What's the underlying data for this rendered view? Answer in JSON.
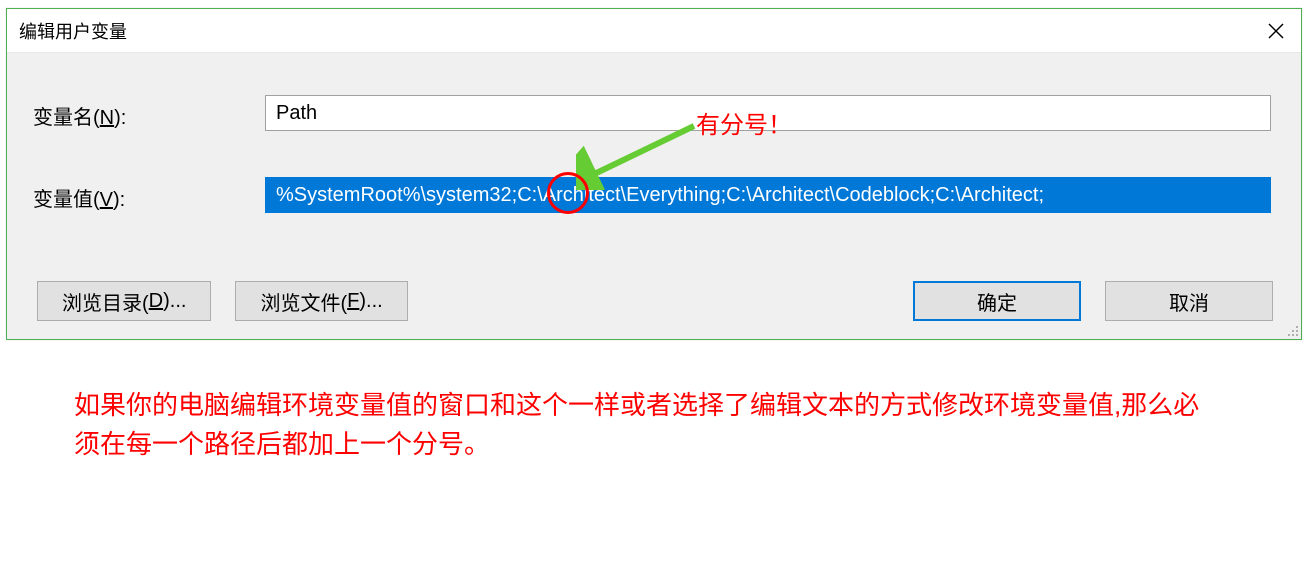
{
  "dialog": {
    "title": "编辑用户变量",
    "name_label_prefix": "变量名(",
    "name_label_key": "N",
    "name_label_suffix": "):",
    "name_value": "Path",
    "value_label_prefix": "变量值(",
    "value_label_key": "V",
    "value_label_suffix": "):",
    "value_value": "%SystemRoot%\\system32;C:\\Architect\\Everything;C:\\Architect\\Codeblock;C:\\Architect;",
    "browse_dir_prefix": "浏览目录(",
    "browse_dir_key": "D",
    "browse_dir_suffix": ")...",
    "browse_file_prefix": "浏览文件(",
    "browse_file_key": "F",
    "browse_file_suffix": ")...",
    "ok": "确定",
    "cancel": "取消"
  },
  "annotations": {
    "callout": "有分号！",
    "explanation": "如果你的电脑编辑环境变量值的窗口和这个一样或者选择了编辑文本的方式修改环境变量值,那么必须在每一个路径后都加上一个分号。"
  }
}
